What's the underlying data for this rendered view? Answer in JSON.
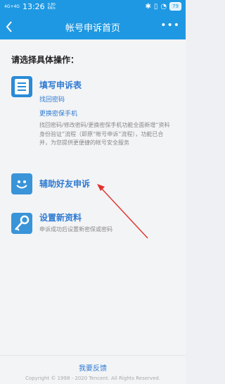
{
  "status_bar": {
    "signal": "4G+4G",
    "time": "13:26",
    "speed": "0.80 KB/s",
    "battery": "79"
  },
  "header": {
    "title": "帐号申诉首页",
    "more": "•••"
  },
  "main": {
    "prompt": "请选择具体操作：",
    "options": [
      {
        "title": "填写申诉表",
        "links": [
          "找回密码",
          "更换密保手机"
        ],
        "description": "找回密码/修改密码/更换密保手机功能全面新增“资料身份验证”流程（即原“帐号申诉”流程），功能已合并，为您提供更便捷的帐号安全服务"
      },
      {
        "title": "辅助好友申诉"
      },
      {
        "title": "设置新资料",
        "description": "申诉成功后设置新密保或密码"
      }
    ]
  },
  "footer": {
    "feedback": "我要反馈",
    "copyright": "Copyright © 1998 - 2020 Tencent. All Rights Reserved."
  },
  "colors": {
    "brand_blue": "#1e98e2",
    "link_blue": "#2e7ad2",
    "annotation_arrow": "#e0322c"
  }
}
